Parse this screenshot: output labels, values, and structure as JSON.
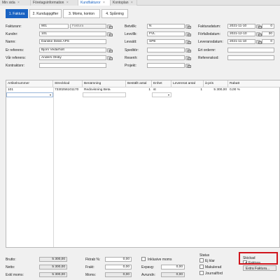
{
  "window_tabs": [
    "Min sida",
    "Företagsinformation",
    "Kundfakturor",
    "Kontoplan"
  ],
  "sub_tabs": [
    "1. Faktura",
    "2. Kunduppgifter",
    "3. Moms, konton",
    "4. Spårning"
  ],
  "header": {
    "fakturanr_label": "Fakturanr:",
    "fakturanr": "901",
    "fakturanr_type": "Faktura",
    "kundnr_label": "Kundnr:",
    "kundnr": "101",
    "namn_label": "Namn:",
    "namn": "Danske Disks APS",
    "er_ref_label": "Er referens:",
    "er_ref": "Bjorn Vedarholt",
    "var_ref_label": "Vår referens:",
    "var_ref": "Anders Olsby",
    "kontraktsnr_label": "Kontraktsnr:",
    "betvillk_label": "Betvillk:",
    "betvillk": "N",
    "levvillk_label": "Levvillk:",
    "levvillk": "FVL",
    "levsatt_label": "Levsätt:",
    "levsatt": "SPE",
    "speditor_label": "Speditör:",
    "resenh_label": "Resenh:",
    "projekt_label": "Projekt:",
    "fakturadatum_label": "Fakturadatum:",
    "fakturadatum": "2021-11-10",
    "forfallodatum_label": "Förfallodatum:",
    "forfallodatum": "2021-12-10",
    "leveransdatum_label": "Leveransdatum:",
    "leveransdatum": "2021-11-10",
    "ert_ordernr_label": "Ert ordernr:",
    "referenskod_label": "Referenskod:",
    "days_1": "0",
    "days_2": "30",
    "days_3": "0"
  },
  "grid": {
    "columns": [
      "Artikelnummer",
      "Streckkod",
      "Benämning",
      "Beställt antal",
      "Enhet",
      "Levererat antal",
      "à-pris",
      "Rabatt"
    ],
    "row": [
      "101",
      "7330256101170",
      "Redovisning Beta",
      "1",
      "st",
      "1",
      "5 300,00",
      "0,00 %"
    ]
  },
  "totals": {
    "brutto_label": "Brutto:",
    "brutto": "5 300,00",
    "netto_label": "Netto:",
    "netto": "5 300,00",
    "exkl_moms_label": "Exkl moms:",
    "exkl_moms": "5 300,00",
    "fktrab_label": "Fktrab %:",
    "fktrab": "0,00",
    "frakt_label": "Frakt:",
    "frakt": "0,00",
    "moms_label": "Moms:",
    "moms": "0,00",
    "inklusive_moms_label": "Inklusive moms",
    "expavg_label": "Expavg:",
    "expavg": "0,00",
    "avrundn_label": "Avrundn:",
    "avrundn": "0,00"
  },
  "status": {
    "title": "Status",
    "items": [
      "Ej klar",
      "Makulerad",
      "Journalförd"
    ]
  },
  "skickad": {
    "title": "Skickad",
    "items": [
      "Faktura",
      "Extra Faktura..."
    ]
  },
  "colors": {
    "accent": "#1a63c2",
    "highlight": "#d0141c"
  }
}
